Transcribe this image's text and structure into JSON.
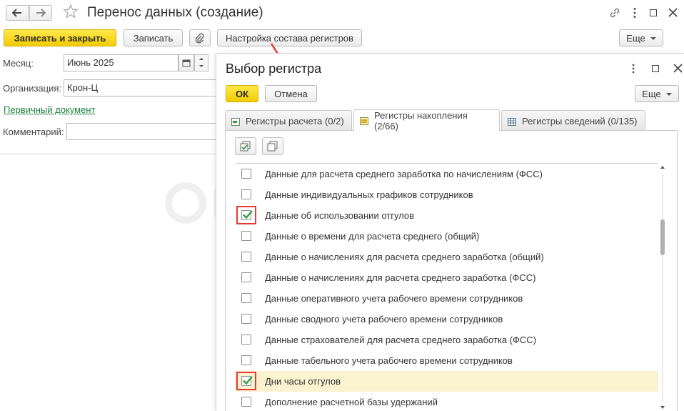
{
  "main": {
    "title": "Перенос данных (создание)",
    "save_close_label": "Записать и закрыть",
    "save_label": "Записать",
    "settings_label": "Настройка состава регистров",
    "more_label": "Еще",
    "fields": {
      "month_label": "Месяц:",
      "month_value": "Июнь 2025",
      "org_label": "Организация:",
      "org_value": "Крон-Ц",
      "primary_doc_link": "Первичный документ",
      "comment_label": "Комментарий:",
      "comment_value": ""
    }
  },
  "dialog": {
    "title": "Выбор регистра",
    "ok_label": "ОК",
    "cancel_label": "Отмена",
    "more_label": "Еще",
    "tabs": [
      {
        "label": "Регистры расчета (0/2)",
        "active": false
      },
      {
        "label": "Регистры накопления (2/66)",
        "active": true
      },
      {
        "label": "Регистры сведений (0/135)",
        "active": false
      }
    ],
    "registers": [
      {
        "label": "Данные для расчета среднего заработка по начислениям (ФСС)",
        "checked": false
      },
      {
        "label": "Данные индивидуальных графиков сотрудников",
        "checked": false
      },
      {
        "label": "Данные об использовании отгулов",
        "checked": true
      },
      {
        "label": "Данные о времени для расчета среднего (общий)",
        "checked": false
      },
      {
        "label": "Данные о начислениях для расчета среднего заработка (общий)",
        "checked": false
      },
      {
        "label": "Данные о начислениях для расчета среднего заработка (ФСС)",
        "checked": false
      },
      {
        "label": "Данные оперативного учета рабочего времени сотрудников",
        "checked": false
      },
      {
        "label": "Данные сводного учета рабочего времени сотрудников",
        "checked": false
      },
      {
        "label": "Данные страхователей для расчета среднего заработка (ФСС)",
        "checked": false
      },
      {
        "label": "Данные табельного учета рабочего времени сотрудников",
        "checked": false
      },
      {
        "label": "Дни часы отгулов",
        "checked": true,
        "highlighted": true
      },
      {
        "label": "Дополнение расчетной базы удержаний",
        "checked": false
      }
    ]
  },
  "colors": {
    "accent_yellow": "#f3cb06",
    "link_green": "#1b7f3d",
    "marker_red": "#e53935",
    "check_green": "#2e9e3e",
    "highlight": "#fbf2cf"
  }
}
